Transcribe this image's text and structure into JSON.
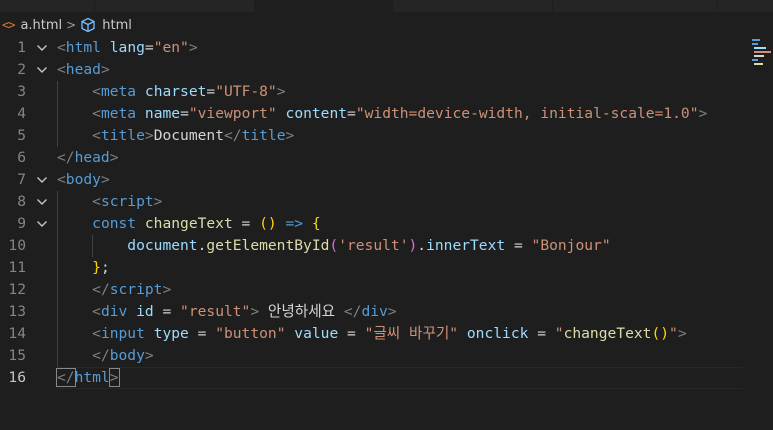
{
  "breadcrumb": {
    "file_icon": "<>",
    "file_name": "a.html",
    "separator": ">",
    "element_icon": "cube-icon",
    "element_name": "html"
  },
  "colors": {
    "background": "#1e1e1e",
    "tag": "#569cd6",
    "attribute": "#9cdcfe",
    "string": "#ce9178",
    "function": "#dcdcaa",
    "bracket_punct": "#808080",
    "bracket_gold": "#ffd700",
    "bracket_orchid": "#da70d6",
    "line_number": "#858585"
  },
  "lines": [
    {
      "n": "1",
      "tokens": [
        [
          "b",
          "<"
        ],
        [
          "tag",
          "html"
        ],
        [
          "t",
          " "
        ],
        [
          "attr",
          "lang"
        ],
        [
          "t",
          "="
        ],
        [
          "str",
          "\"en\""
        ],
        [
          "b",
          ">"
        ]
      ]
    },
    {
      "n": "2",
      "tokens": [
        [
          "b",
          "<"
        ],
        [
          "tag",
          "head"
        ],
        [
          "b",
          ">"
        ]
      ]
    },
    {
      "n": "3",
      "tokens": [
        [
          "t",
          "    "
        ],
        [
          "b",
          "<"
        ],
        [
          "tag",
          "meta"
        ],
        [
          "t",
          " "
        ],
        [
          "attr",
          "charset"
        ],
        [
          "t",
          "="
        ],
        [
          "str",
          "\"UTF-8\""
        ],
        [
          "b",
          ">"
        ]
      ]
    },
    {
      "n": "4",
      "tokens": [
        [
          "t",
          "    "
        ],
        [
          "b",
          "<"
        ],
        [
          "tag",
          "meta"
        ],
        [
          "t",
          " "
        ],
        [
          "attr",
          "name"
        ],
        [
          "t",
          "="
        ],
        [
          "str",
          "\"viewport\""
        ],
        [
          "t",
          " "
        ],
        [
          "attr",
          "content"
        ],
        [
          "t",
          "="
        ],
        [
          "str",
          "\"width=device-width, initial-scale=1.0\""
        ],
        [
          "b",
          ">"
        ]
      ]
    },
    {
      "n": "5",
      "tokens": [
        [
          "t",
          "    "
        ],
        [
          "b",
          "<"
        ],
        [
          "tag",
          "title"
        ],
        [
          "b",
          ">"
        ],
        [
          "t",
          "Document"
        ],
        [
          "b",
          "</"
        ],
        [
          "tag",
          "title"
        ],
        [
          "b",
          ">"
        ]
      ]
    },
    {
      "n": "6",
      "tokens": [
        [
          "b",
          "</"
        ],
        [
          "tag",
          "head"
        ],
        [
          "b",
          ">"
        ]
      ]
    },
    {
      "n": "7",
      "tokens": [
        [
          "b",
          "<"
        ],
        [
          "tag",
          "body"
        ],
        [
          "b",
          ">"
        ]
      ]
    },
    {
      "n": "8",
      "tokens": [
        [
          "t",
          "    "
        ],
        [
          "b",
          "<"
        ],
        [
          "tag",
          "script"
        ],
        [
          "b",
          ">"
        ]
      ]
    },
    {
      "n": "9",
      "tokens": [
        [
          "t",
          "    "
        ],
        [
          "kw",
          "const"
        ],
        [
          "t",
          " "
        ],
        [
          "fn",
          "changeText"
        ],
        [
          "t",
          " = "
        ],
        [
          "p1",
          "()"
        ],
        [
          "t",
          " "
        ],
        [
          "kw",
          "=>"
        ],
        [
          "t",
          " "
        ],
        [
          "p1",
          "{"
        ]
      ]
    },
    {
      "n": "10",
      "tokens": [
        [
          "t",
          "        "
        ],
        [
          "var",
          "document"
        ],
        [
          "t",
          "."
        ],
        [
          "fn",
          "getElementById"
        ],
        [
          "p2",
          "("
        ],
        [
          "str",
          "'result'"
        ],
        [
          "p2",
          ")"
        ],
        [
          "t",
          "."
        ],
        [
          "var",
          "innerText"
        ],
        [
          "t",
          " = "
        ],
        [
          "str",
          "\"Bonjour\""
        ]
      ]
    },
    {
      "n": "11",
      "tokens": [
        [
          "t",
          "    "
        ],
        [
          "p1",
          "}"
        ],
        [
          "t",
          ";"
        ]
      ]
    },
    {
      "n": "12",
      "tokens": [
        [
          "t",
          "    "
        ],
        [
          "b",
          "</"
        ],
        [
          "tag",
          "script"
        ],
        [
          "b",
          ">"
        ]
      ]
    },
    {
      "n": "13",
      "tokens": [
        [
          "t",
          "    "
        ],
        [
          "b",
          "<"
        ],
        [
          "tag",
          "div"
        ],
        [
          "t",
          " "
        ],
        [
          "attr",
          "id"
        ],
        [
          "t",
          " = "
        ],
        [
          "str",
          "\"result\""
        ],
        [
          "b",
          ">"
        ],
        [
          "t",
          " 안녕하세요 "
        ],
        [
          "b",
          "</"
        ],
        [
          "tag",
          "div"
        ],
        [
          "b",
          ">"
        ]
      ]
    },
    {
      "n": "14",
      "tokens": [
        [
          "t",
          "    "
        ],
        [
          "b",
          "<"
        ],
        [
          "tag",
          "input"
        ],
        [
          "t",
          " "
        ],
        [
          "attr",
          "type"
        ],
        [
          "t",
          " = "
        ],
        [
          "str",
          "\"button\""
        ],
        [
          "t",
          " "
        ],
        [
          "attr",
          "value"
        ],
        [
          "t",
          " = "
        ],
        [
          "str",
          "\"글씨 바꾸기\""
        ],
        [
          "t",
          " "
        ],
        [
          "attr",
          "onclick"
        ],
        [
          "t",
          " = "
        ],
        [
          "str",
          "\""
        ],
        [
          "fn",
          "changeText"
        ],
        [
          "p1",
          "()"
        ],
        [
          "str",
          "\""
        ],
        [
          "b",
          ">"
        ]
      ]
    },
    {
      "n": "15",
      "tokens": [
        [
          "t",
          "    "
        ],
        [
          "b",
          "</"
        ],
        [
          "tag",
          "body"
        ],
        [
          "b",
          ">"
        ]
      ]
    },
    {
      "n": "16",
      "tokens": [
        [
          "bm",
          "</"
        ],
        [
          "tag",
          "html"
        ],
        [
          "bm",
          ">"
        ]
      ]
    }
  ]
}
